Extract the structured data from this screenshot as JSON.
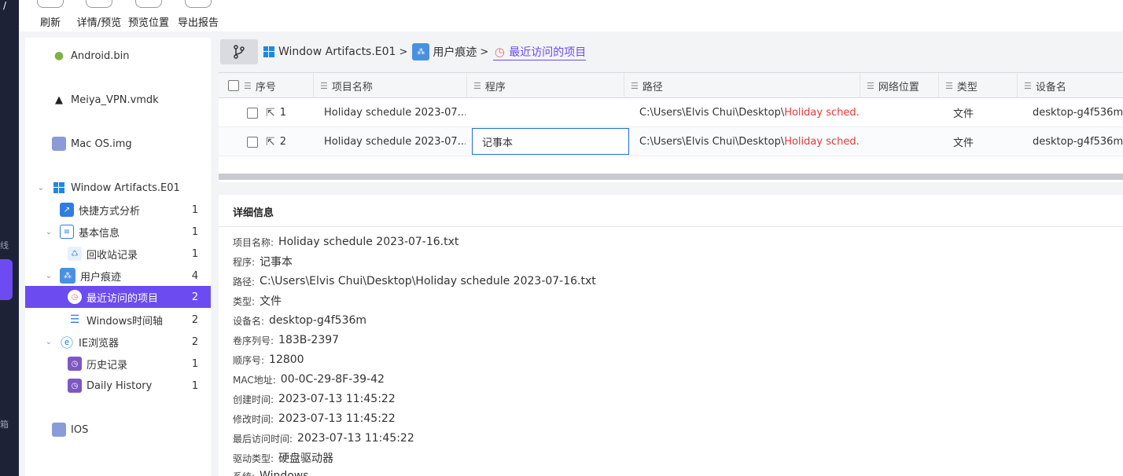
{
  "toolbar": {
    "buttons": [
      {
        "label": "刷新"
      },
      {
        "label": "详情/预览"
      },
      {
        "label": "预览位置"
      },
      {
        "label": "导出报告"
      }
    ]
  },
  "rail": {
    "glyphs": [
      "",
      "",
      "",
      "",
      "线",
      "",
      "",
      "",
      "箱"
    ]
  },
  "tree": {
    "items": [
      {
        "label": "Android.bin",
        "count": "",
        "icon": "android-icon"
      },
      {
        "label": "Meiya_VPN.vmdk",
        "count": "",
        "icon": "linux-icon"
      },
      {
        "label": "Mac OS.img",
        "count": "",
        "icon": "disk-image-icon"
      },
      {
        "label": "Window Artifacts.E01",
        "count": "",
        "icon": "windows-icon"
      },
      {
        "label": "快捷方式分析",
        "count": "1",
        "icon": "shortcut-folder-icon"
      },
      {
        "label": "基本信息",
        "count": "1",
        "icon": "list-icon"
      },
      {
        "label": "回收站记录",
        "count": "1",
        "icon": "recycle-bin-icon"
      },
      {
        "label": "用户痕迹",
        "count": "4",
        "icon": "footprints-icon"
      },
      {
        "label": "最近访问的项目",
        "count": "2",
        "icon": "recent-clock-icon"
      },
      {
        "label": "Windows时间轴",
        "count": "2",
        "icon": "timeline-icon"
      },
      {
        "label": "IE浏览器",
        "count": "2",
        "icon": "ie-icon"
      },
      {
        "label": "历史记录",
        "count": "1",
        "icon": "history-icon"
      },
      {
        "label": "Daily History",
        "count": "1",
        "icon": "history-icon"
      },
      {
        "label": "IOS",
        "count": "",
        "icon": "disk-image-icon"
      }
    ]
  },
  "breadcrumb": {
    "items": [
      "Window Artifacts.E01",
      "用户痕迹",
      "最近访问的项目"
    ],
    "separator": ">"
  },
  "grid": {
    "columns": [
      "序号",
      "项目名称",
      "程序",
      "路径",
      "网络位置",
      "类型",
      "设备名"
    ],
    "rows": [
      {
        "index": "1",
        "name": "Holiday schedule 2023-07...",
        "program": "",
        "path_prefix": "C:\\Users\\Elvis Chui\\Desktop\\",
        "path_file": "Holiday sched...",
        "network": "",
        "type": "文件",
        "device": "desktop-g4f536m"
      },
      {
        "index": "2",
        "name": "Holiday schedule 2023-07...",
        "program": "记事本",
        "path_prefix": "C:\\Users\\Elvis Chui\\Desktop\\",
        "path_file": "Holiday sched...",
        "network": "",
        "type": "文件",
        "device": "desktop-g4f536m"
      }
    ]
  },
  "detail": {
    "title": "详细信息",
    "fields": [
      {
        "key": "项目名称:",
        "value": "Holiday schedule 2023-07-16.txt"
      },
      {
        "key": "程序:",
        "value": "记事本"
      },
      {
        "key": "路径:",
        "value": "C:\\Users\\Elvis Chui\\Desktop\\",
        "value_red": "Holiday schedule 2023-07-16.txt"
      },
      {
        "key": "类型:",
        "value": "文件"
      },
      {
        "key": "设备名:",
        "value": "desktop-g4f536m"
      },
      {
        "key": "卷序列号:",
        "value": "183B-2397"
      },
      {
        "key": "顺序号:",
        "value": "12800"
      },
      {
        "key": "MAC地址:",
        "value": "00-0C-29-8F-39-42"
      },
      {
        "key": "创建时间:",
        "value": "2023-07-13 11:45:22"
      },
      {
        "key": "修改时间:",
        "value": "2023-07-13 11:45:22"
      },
      {
        "key": "最后访问时间:",
        "value": "2023-07-13 11:45:22"
      },
      {
        "key": "驱动类型:",
        "value": "硬盘驱动器"
      },
      {
        "key": "系统:",
        "value": "Windows"
      }
    ]
  },
  "colors": {
    "accent": "#6c4cf0",
    "rail": "#1e2236",
    "highlight_red": "#e53935",
    "edit_border": "#1e6fd9"
  }
}
